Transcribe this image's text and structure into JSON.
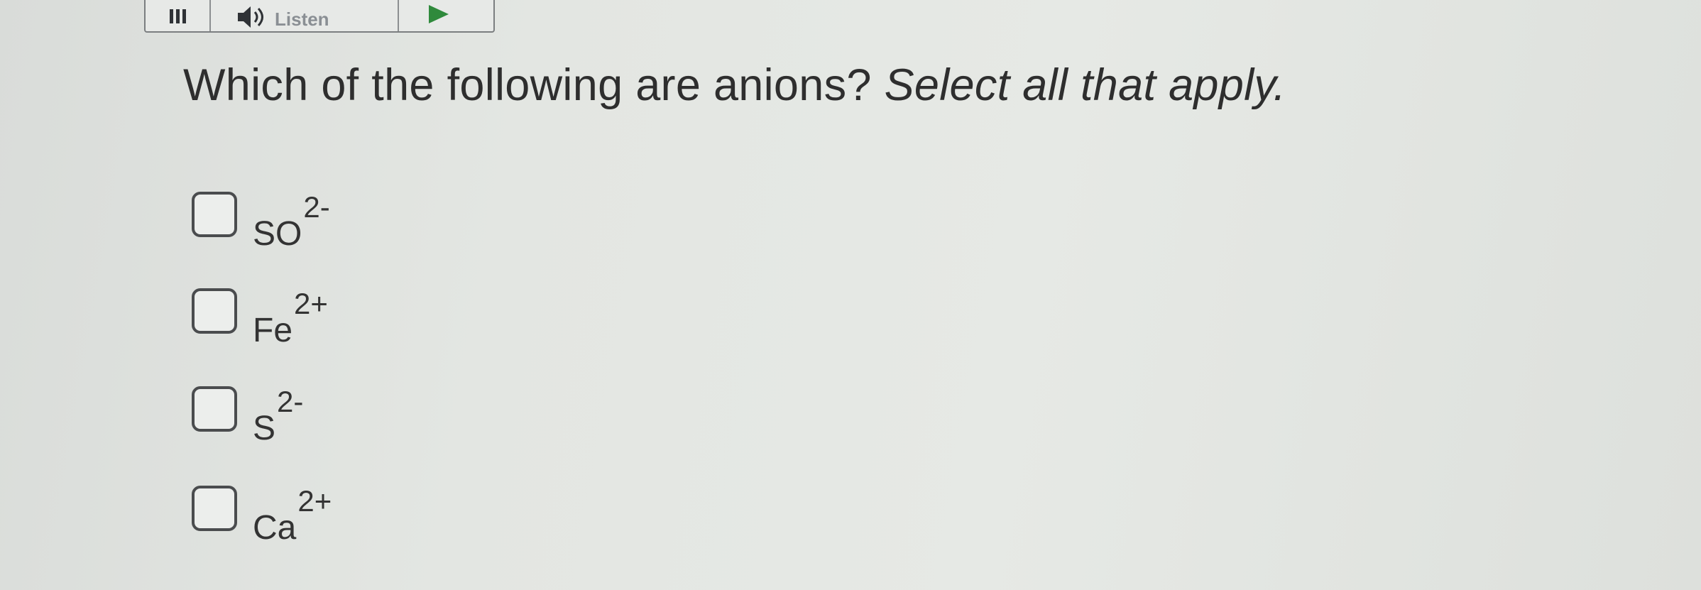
{
  "toolbar": {
    "menu_icon": "menu-icon",
    "listen_icon": "speaker-icon",
    "listen_label": "Listen",
    "play_icon": "play-icon",
    "accent_color": "#2f8a3c"
  },
  "question": {
    "prompt": "Which of the following are anions?",
    "instruction": "Select all that apply."
  },
  "options": [
    {
      "symbol": "SO",
      "charge": "2-",
      "checked": false
    },
    {
      "symbol": "Fe",
      "charge": "2+",
      "checked": false
    },
    {
      "symbol": "S",
      "charge": "2-",
      "checked": false
    },
    {
      "symbol": "Ca",
      "charge": "2+",
      "checked": false
    }
  ]
}
